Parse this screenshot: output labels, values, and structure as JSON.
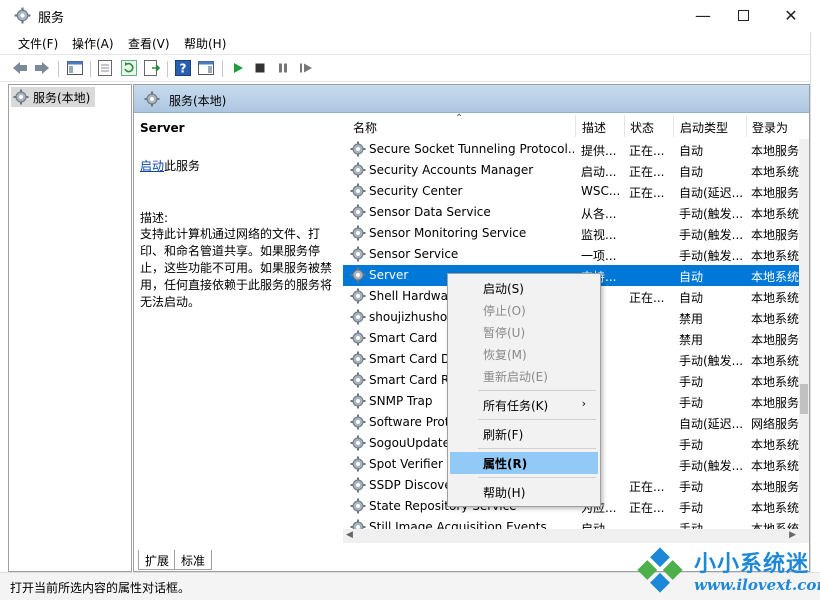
{
  "window": {
    "title": "服务"
  },
  "menu": [
    "文件(F)",
    "操作(A)",
    "查看(V)",
    "帮助(H)"
  ],
  "tree": {
    "item": "服务(本地)"
  },
  "panel": {
    "header": "服务(本地)"
  },
  "details": {
    "service_name": "Server",
    "start_link": "启动",
    "start_suffix": "此服务",
    "desc_label": "描述:",
    "desc_text": "支持此计算机通过网络的文件、打印、和命名管道共享。如果服务停止，这些功能不可用。如果服务被禁用，任何直接依赖于此服务的服务将无法启动。"
  },
  "columns": [
    "名称",
    "描述",
    "状态",
    "启动类型",
    "登录为"
  ],
  "rows": [
    {
      "name": "Secure Socket Tunneling Protocol...",
      "desc": "提供...",
      "status": "正在...",
      "start": "自动",
      "logon": "本地服务"
    },
    {
      "name": "Security Accounts Manager",
      "desc": "启动...",
      "status": "正在...",
      "start": "自动",
      "logon": "本地系统"
    },
    {
      "name": "Security Center",
      "desc": "WSC...",
      "status": "正在...",
      "start": "自动(延迟...",
      "logon": "本地服务"
    },
    {
      "name": "Sensor Data Service",
      "desc": "从各...",
      "status": "",
      "start": "手动(触发...",
      "logon": "本地系统"
    },
    {
      "name": "Sensor Monitoring Service",
      "desc": "监视...",
      "status": "",
      "start": "手动(触发...",
      "logon": "本地服务"
    },
    {
      "name": "Sensor Service",
      "desc": "一项...",
      "status": "",
      "start": "手动(触发...",
      "logon": "本地系统"
    },
    {
      "name": "Server",
      "desc": "支持...",
      "status": "",
      "start": "自动",
      "logon": "本地系统"
    },
    {
      "name": "Shell Hardware Detection",
      "desc": "",
      "status": "正在...",
      "start": "自动",
      "logon": "本地系统"
    },
    {
      "name": "shoujizhushou",
      "desc": "",
      "status": "",
      "start": "禁用",
      "logon": "本地系统"
    },
    {
      "name": "Smart Card",
      "desc": "",
      "status": "",
      "start": "禁用",
      "logon": "本地服务"
    },
    {
      "name": "Smart Card Device Enumeration",
      "desc": "",
      "status": "",
      "start": "手动(触发...",
      "logon": "本地系统"
    },
    {
      "name": "Smart Card Removal Policy",
      "desc": "",
      "status": "",
      "start": "手动",
      "logon": "本地系统"
    },
    {
      "name": "SNMP Trap",
      "desc": "",
      "status": "",
      "start": "手动",
      "logon": "本地服务"
    },
    {
      "name": "Software Protection",
      "desc": "",
      "status": "",
      "start": "自动(延迟...",
      "logon": "网络服务"
    },
    {
      "name": "SogouUpdate",
      "desc": "",
      "status": "",
      "start": "手动",
      "logon": "本地系统"
    },
    {
      "name": "Spot Verifier",
      "desc": "",
      "status": "",
      "start": "手动(触发...",
      "logon": "本地系统"
    },
    {
      "name": "SSDP Discovery",
      "desc": "",
      "status": "正在...",
      "start": "手动",
      "logon": "本地服务"
    },
    {
      "name": "State Repository Service",
      "desc": "为应...",
      "status": "正在...",
      "start": "手动",
      "logon": "本地系统"
    },
    {
      "name": "Still Image Acquisition Events",
      "desc": "启动...",
      "status": "",
      "start": "手动",
      "logon": "本地系统"
    }
  ],
  "tabs": [
    "扩展",
    "标准"
  ],
  "context_menu": {
    "start": "启动(S)",
    "stop": "停止(O)",
    "pause": "暂停(U)",
    "resume": "恢复(M)",
    "restart": "重新启动(E)",
    "all_tasks": "所有任务(K)",
    "refresh": "刷新(F)",
    "properties": "属性(R)",
    "help": "帮助(H)"
  },
  "status": "打开当前所选内容的属性对话框。",
  "watermark": {
    "cn": "小小系统迷",
    "url": "www.ilovext.com"
  },
  "colors": {
    "selection": "#0078d7",
    "menu_highlight": "#91c9f7",
    "header_gradient": "#c8dbee",
    "play_green": "#1e9e3a"
  }
}
